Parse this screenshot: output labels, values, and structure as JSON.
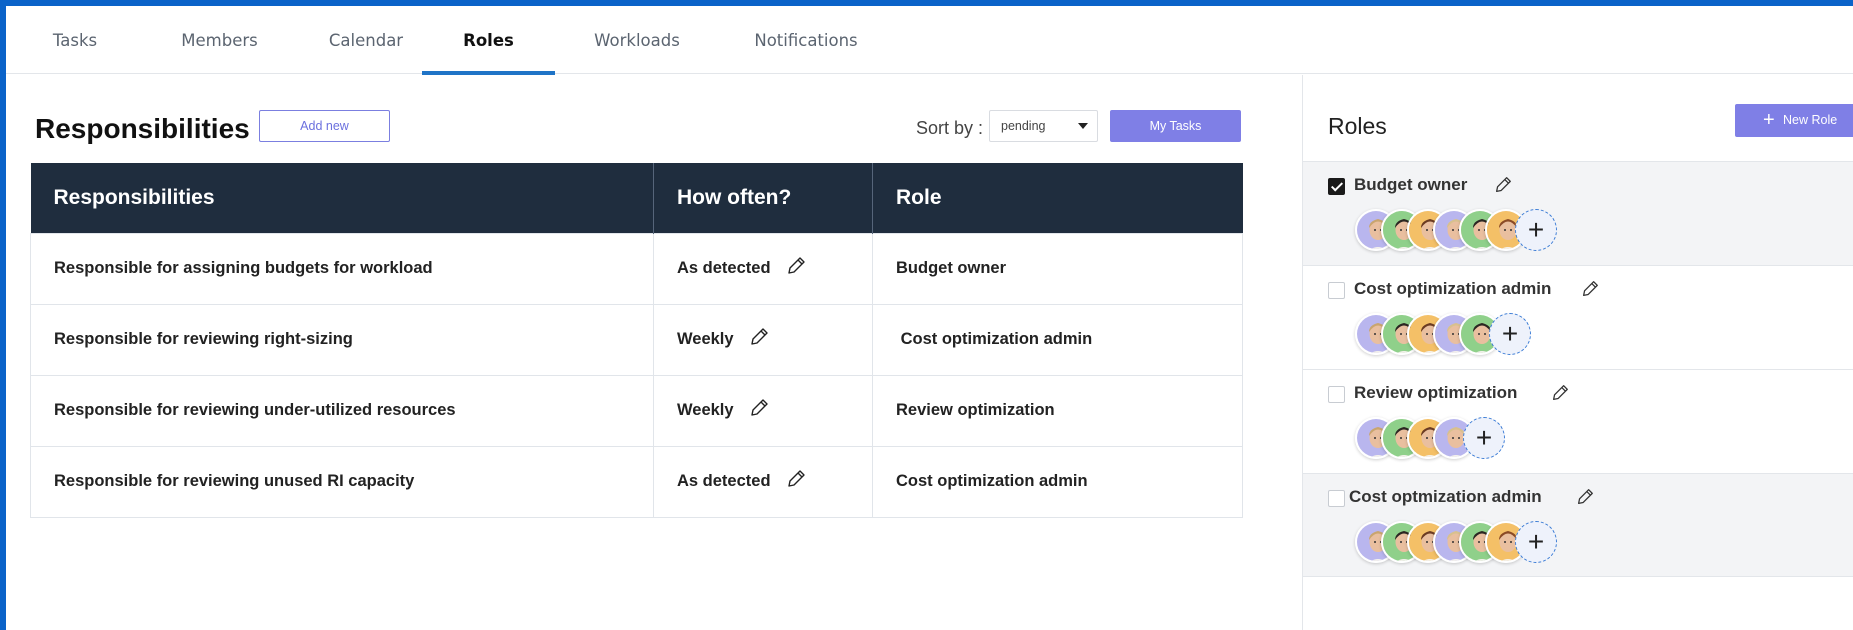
{
  "tabs": [
    {
      "label": "Tasks"
    },
    {
      "label": "Members"
    },
    {
      "label": "Calendar"
    },
    {
      "label": "Roles",
      "active": true
    },
    {
      "label": "Workloads"
    },
    {
      "label": "Notifications"
    }
  ],
  "responsibilities": {
    "title": "Responsibilities",
    "add_new_label": "Add new",
    "sort_label": "Sort by :",
    "sort_value": "pending",
    "my_tasks_label": "My Tasks",
    "columns": [
      "Responsibilities",
      "How often?",
      "Role"
    ],
    "rows": [
      {
        "responsibility": "Responsible for assigning  budgets for workload",
        "frequency": "As detected",
        "role": "Budget owner"
      },
      {
        "responsibility": "Responsible for  reviewing right-sizing",
        "frequency": "Weekly",
        "role": " Cost optimization admin"
      },
      {
        "responsibility": "Responsible for reviewing under-utilized resources",
        "frequency": "Weekly",
        "role": "Review optimization"
      },
      {
        "responsibility": "Responsible for reviewing unused RI capacity",
        "frequency": "As detected",
        "role": "Cost optimization admin"
      }
    ]
  },
  "roles_panel": {
    "title": "Roles",
    "new_role_label": "New Role",
    "roles": [
      {
        "name": "Budget owner",
        "checked": true,
        "members": 6
      },
      {
        "name": "Cost optimization admin",
        "checked": false,
        "members": 5
      },
      {
        "name": "Review optimization",
        "checked": false,
        "members": 4
      },
      {
        "name": "Cost optmization admin",
        "checked": false,
        "members": 6
      }
    ]
  },
  "colors": {
    "accent": "#7f7fe6",
    "table_header": "#1f2d3e",
    "tab_indicator": "#1f74c7",
    "frame": "#0b63c9"
  },
  "icons": {
    "edit": "pencil-icon",
    "add_member": "plus-icon",
    "dropdown": "caret-down-icon"
  }
}
